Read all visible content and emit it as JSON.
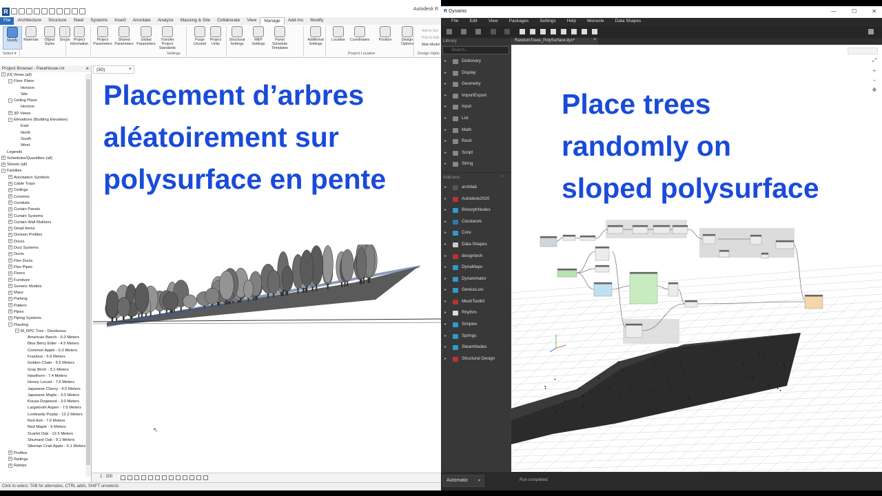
{
  "revit": {
    "app_title": "Autodesk R",
    "tabs": [
      "File",
      "Architecture",
      "Structure",
      "Steel",
      "Systems",
      "Insert",
      "Annotate",
      "Analyze",
      "Massing & Site",
      "Collaborate",
      "View",
      "Manage",
      "Add-Ins",
      "Modify"
    ],
    "active_tab": "Manage",
    "ribbon_tools": [
      {
        "label": "Modify",
        "icon": "cursor-icon"
      },
      {
        "label": "Materials",
        "icon": "sphere-icon"
      },
      {
        "label": "Object Styles",
        "icon": "object-icon"
      },
      {
        "label": "Snaps",
        "icon": "magnet-icon"
      },
      {
        "label": "Project Information",
        "icon": "info-icon"
      },
      {
        "label": "Project Parameters",
        "icon": "parameters-icon"
      },
      {
        "label": "Shared Parameters",
        "icon": "parameters-icon"
      },
      {
        "label": "Global Parameters",
        "icon": "parameters-icon"
      },
      {
        "label": "Transfer Project Standards",
        "icon": "transfer-icon"
      },
      {
        "label": "Purge Unused",
        "icon": "purge-icon"
      },
      {
        "label": "Project Units",
        "icon": "units-icon"
      },
      {
        "label": "Structural Settings",
        "icon": "settings-icon"
      },
      {
        "label": "MEP Settings",
        "icon": "settings-icon"
      },
      {
        "label": "Panel Schedule Templates",
        "icon": "schedule-icon"
      },
      {
        "label": "Additional Settings",
        "icon": "wrench-icon"
      },
      {
        "label": "Location",
        "icon": "globe-icon"
      },
      {
        "label": "Coordinates",
        "icon": "axes-icon"
      },
      {
        "label": "Position",
        "icon": "position-icon"
      },
      {
        "label": "Design Options",
        "icon": "design-options-icon"
      }
    ],
    "side_tools": [
      "Add to Set",
      "Pick to Edit",
      "Main Model"
    ],
    "panel_labels": {
      "select": "Select ▾",
      "settings": "Settings",
      "project_location": "Project Location",
      "design_options": "Design Optio"
    },
    "browser_title": "Project Browser - ParaHouse.rvt",
    "view_tab": "{3D}",
    "tree": [
      {
        "l": 0,
        "t": "-",
        "text": "[O] Views (all)"
      },
      {
        "l": 1,
        "t": "-",
        "text": "Floor Plans"
      },
      {
        "l": 2,
        "t": "",
        "text": "Horizon"
      },
      {
        "l": 2,
        "t": "",
        "text": "Site"
      },
      {
        "l": 1,
        "t": "-",
        "text": "Ceiling Plans"
      },
      {
        "l": 2,
        "t": "",
        "text": "Horizon"
      },
      {
        "l": 1,
        "t": "+",
        "text": "3D Views"
      },
      {
        "l": 1,
        "t": "-",
        "text": "Elevations (Building Elevation)"
      },
      {
        "l": 2,
        "t": "",
        "text": "East"
      },
      {
        "l": 2,
        "t": "",
        "text": "North"
      },
      {
        "l": 2,
        "t": "",
        "text": "South"
      },
      {
        "l": 2,
        "t": "",
        "text": "West"
      },
      {
        "l": 0,
        "t": "",
        "text": "Legends"
      },
      {
        "l": 0,
        "t": "+",
        "text": "Schedules/Quantities (all)"
      },
      {
        "l": 0,
        "t": "+",
        "text": "Sheets (all)"
      },
      {
        "l": 0,
        "t": "-",
        "text": "Families"
      },
      {
        "l": 1,
        "t": "+",
        "text": "Annotation Symbols"
      },
      {
        "l": 1,
        "t": "+",
        "text": "Cable Trays"
      },
      {
        "l": 1,
        "t": "+",
        "text": "Ceilings"
      },
      {
        "l": 1,
        "t": "+",
        "text": "Columns"
      },
      {
        "l": 1,
        "t": "+",
        "text": "Conduits"
      },
      {
        "l": 1,
        "t": "+",
        "text": "Curtain Panels"
      },
      {
        "l": 1,
        "t": "+",
        "text": "Curtain Systems"
      },
      {
        "l": 1,
        "t": "+",
        "text": "Curtain Wall Mullions"
      },
      {
        "l": 1,
        "t": "+",
        "text": "Detail Items"
      },
      {
        "l": 1,
        "t": "+",
        "text": "Division Profiles"
      },
      {
        "l": 1,
        "t": "+",
        "text": "Doors"
      },
      {
        "l": 1,
        "t": "+",
        "text": "Duct Systems"
      },
      {
        "l": 1,
        "t": "+",
        "text": "Ducts"
      },
      {
        "l": 1,
        "t": "+",
        "text": "Flex Ducts"
      },
      {
        "l": 1,
        "t": "+",
        "text": "Flex Pipes"
      },
      {
        "l": 1,
        "t": "+",
        "text": "Floors"
      },
      {
        "l": 1,
        "t": "+",
        "text": "Furniture"
      },
      {
        "l": 1,
        "t": "+",
        "text": "Generic Models"
      },
      {
        "l": 1,
        "t": "+",
        "text": "Mass"
      },
      {
        "l": 1,
        "t": "+",
        "text": "Parking"
      },
      {
        "l": 1,
        "t": "+",
        "text": "Pattern"
      },
      {
        "l": 1,
        "t": "+",
        "text": "Pipes"
      },
      {
        "l": 1,
        "t": "+",
        "text": "Piping Systems"
      },
      {
        "l": 1,
        "t": "-",
        "text": "Planting"
      },
      {
        "l": 2,
        "t": "-",
        "text": "M_RPC Tree - Deciduous"
      },
      {
        "l": 3,
        "t": "",
        "text": "American Beech - 6.0 Meters"
      },
      {
        "l": 3,
        "t": "",
        "text": "Blue Berry Elder - 4.5 Meters"
      },
      {
        "l": 3,
        "t": "",
        "text": "Common Apple - 6.0 Meters"
      },
      {
        "l": 3,
        "t": "",
        "text": "Fraxinus - 5.6 Meters"
      },
      {
        "l": 3,
        "t": "",
        "text": "Golden Chain - 5.5 Meters"
      },
      {
        "l": 3,
        "t": "",
        "text": "Gray Birch - 3.1 Meters"
      },
      {
        "l": 3,
        "t": "",
        "text": "Hawthorn - 7.4 Meters"
      },
      {
        "l": 3,
        "t": "",
        "text": "Honey Locust - 7.6 Meters"
      },
      {
        "l": 3,
        "t": "",
        "text": "Japanese Cherry - 4.5 Meters"
      },
      {
        "l": 3,
        "t": "",
        "text": "Japanese Maple - 3.0 Meters"
      },
      {
        "l": 3,
        "t": "",
        "text": "Kousa Dogwood - 3.0 Meters"
      },
      {
        "l": 3,
        "t": "",
        "text": "Largetooth Aspen - 7.6 Meters"
      },
      {
        "l": 3,
        "t": "",
        "text": "Lombardy Poplar - 12.2 Meters"
      },
      {
        "l": 3,
        "t": "",
        "text": "Red Ash - 7.6 Meters"
      },
      {
        "l": 3,
        "t": "",
        "text": "Red Maple - 9 Meters"
      },
      {
        "l": 3,
        "t": "",
        "text": "Scarlet Oak - 12.5 Meters"
      },
      {
        "l": 3,
        "t": "",
        "text": "Shumard Oak - 9.1 Meters"
      },
      {
        "l": 3,
        "t": "",
        "text": "Siberian Crab Apple - 6.1 Meters"
      },
      {
        "l": 1,
        "t": "+",
        "text": "Profiles"
      },
      {
        "l": 1,
        "t": "+",
        "text": "Railings"
      },
      {
        "l": 1,
        "t": "+",
        "text": "Ramps"
      }
    ],
    "overlay_lines": [
      "Placement d’arbres",
      "aléatoirement sur",
      "polysurface en pente"
    ],
    "scale": "1 : 200",
    "status": "Click to select, TAB for alternates, CTRL adds, SHIFT unselects."
  },
  "dynamo": {
    "title": "Dynamo",
    "window_controls": [
      "—",
      "☐",
      "✕"
    ],
    "menu": [
      "File",
      "Edit",
      "View",
      "Packages",
      "Settings",
      "Help",
      "Monocle",
      "Data Shapes"
    ],
    "file_tab": "RandomTrees_PolySurface.dyn*",
    "library_header": "Library",
    "search_placeholder": "Search...",
    "library_items": [
      {
        "label": "Dictionary",
        "icon": "dictionary-icon",
        "glyph": "≡"
      },
      {
        "label": "Display",
        "icon": "display-icon",
        "glyph": "◐"
      },
      {
        "label": "Geometry",
        "icon": "geometry-icon",
        "glyph": "◇"
      },
      {
        "label": "ImportExport",
        "icon": "import-export-icon",
        "glyph": "⇄"
      },
      {
        "label": "Input",
        "icon": "input-icon",
        "glyph": "→"
      },
      {
        "label": "List",
        "icon": "list-icon",
        "glyph": "≡"
      },
      {
        "label": "Math",
        "icon": "math-icon",
        "glyph": "x"
      },
      {
        "label": "Revit",
        "icon": "revit-icon",
        "glyph": "R"
      },
      {
        "label": "Script",
        "icon": "script-icon",
        "glyph": "<>"
      },
      {
        "label": "String",
        "icon": "string-icon",
        "glyph": "a"
      }
    ],
    "addons_label": "Add-ons",
    "addon_items": [
      {
        "label": "archilab",
        "icon": "package-icon"
      },
      {
        "label": "Autodesk2020",
        "icon": "package-icon"
      },
      {
        "label": "BimorphNodes",
        "icon": "package-icon"
      },
      {
        "label": "Clockwork",
        "icon": "package-icon"
      },
      {
        "label": "Core",
        "icon": "package-icon"
      },
      {
        "label": "Data-Shapes",
        "icon": "package-icon"
      },
      {
        "label": "designtech",
        "icon": "package-icon"
      },
      {
        "label": "DynaMaps",
        "icon": "package-icon"
      },
      {
        "label": "Dynanimator",
        "icon": "package-icon"
      },
      {
        "label": "GeniusLoci",
        "icon": "package-icon"
      },
      {
        "label": "MeshToolkit",
        "icon": "package-icon"
      },
      {
        "label": "Rhythm",
        "icon": "package-icon"
      },
      {
        "label": "Simplex",
        "icon": "package-icon"
      },
      {
        "label": "Springs",
        "icon": "package-icon"
      },
      {
        "label": "SteamNodes",
        "icon": "package-icon"
      },
      {
        "label": "Structural Design",
        "icon": "package-icon"
      }
    ],
    "overlay_lines": [
      "Place trees",
      "randomly on",
      "sloped polysurface"
    ],
    "run_mode": "Automatic",
    "run_message": "Run completed."
  },
  "colors": {
    "overlay_text": "#1a4bd8",
    "dynamo_bg": "#3c3c3c",
    "revit_tab": "#2a6ebb"
  }
}
